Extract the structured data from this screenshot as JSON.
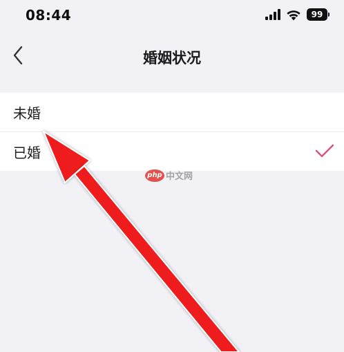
{
  "status_bar": {
    "time": "08:44",
    "battery_level": "99"
  },
  "nav": {
    "title": "婚姻状况",
    "back_icon": "chevron-left-icon"
  },
  "options": [
    {
      "label": "未婚",
      "selected": false
    },
    {
      "label": "已婚",
      "selected": true
    }
  ],
  "watermark": {
    "logo_text": "php",
    "text": "中文网"
  },
  "colors": {
    "background": "#f2f1f6",
    "check_accent": "#d4557a",
    "arrow": "#ee1b1b"
  }
}
